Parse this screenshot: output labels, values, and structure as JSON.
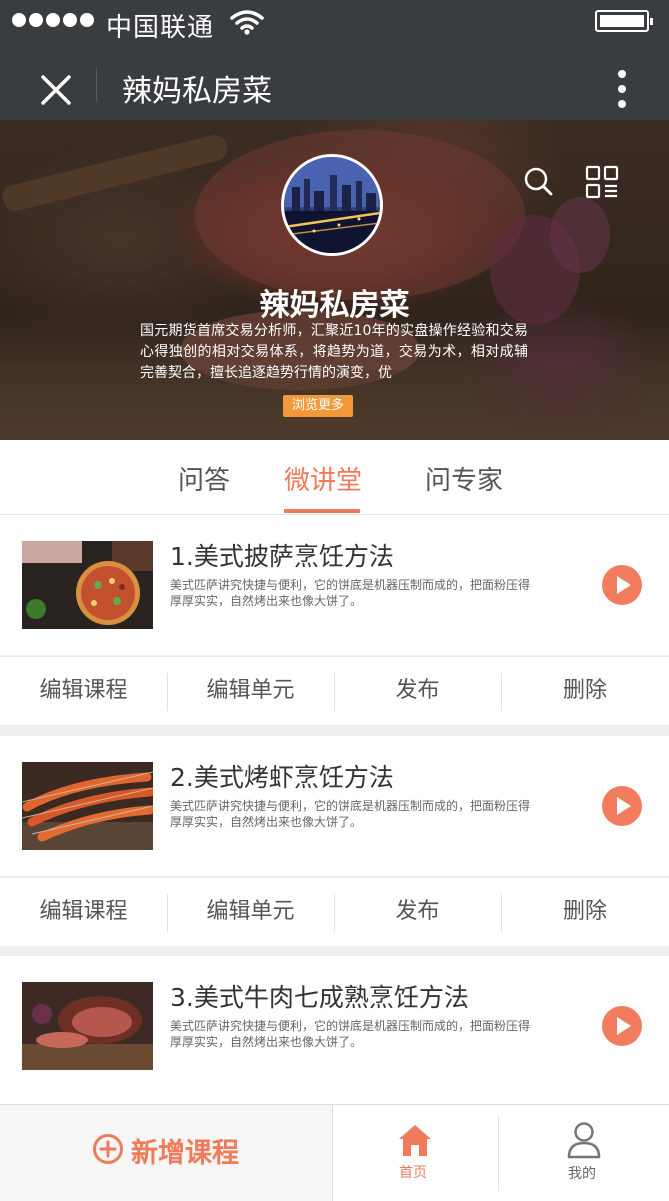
{
  "status_bar": {
    "carrier": "中国联通"
  },
  "nav": {
    "title": "辣妈私房菜"
  },
  "profile": {
    "name": "辣妈私房菜",
    "description": "国元期货首席交易分析师，汇聚近10年的实盘操作经验和交易心得独创的相对交易体系，将趋势为道，交易为术，相对成辅完善契合，擅长追逐趋势行情的演变，优",
    "browse_more": "浏览更多"
  },
  "tabs": [
    {
      "label": "问答"
    },
    {
      "label": "微讲堂",
      "active": true
    },
    {
      "label": "问专家"
    }
  ],
  "courses": [
    {
      "title": "1.美式披萨烹饪方法",
      "description": "美式匹萨讲究快捷与便利，它的饼底是机器压制而成的，把面粉压得厚厚实实，自然烤出来也像大饼了。"
    },
    {
      "title": "2.美式烤虾烹饪方法",
      "description": "美式匹萨讲究快捷与便利，它的饼底是机器压制而成的，把面粉压得厚厚实实，自然烤出来也像大饼了。"
    },
    {
      "title": "3.美式牛肉七成熟烹饪方法",
      "description": "美式匹萨讲究快捷与便利，它的饼底是机器压制而成的，把面粉压得厚厚实实，自然烤出来也像大饼了。"
    }
  ],
  "course_actions": {
    "edit_course": "编辑课程",
    "edit_unit": "编辑单元",
    "publish": "发布",
    "delete": "删除"
  },
  "bottom_bar": {
    "add_course": "新增课程",
    "home": "首页",
    "mine": "我的"
  },
  "colors": {
    "accent": "#f07b5a",
    "header_bg": "#3a3d40",
    "browse_button": "#f29a3b"
  }
}
